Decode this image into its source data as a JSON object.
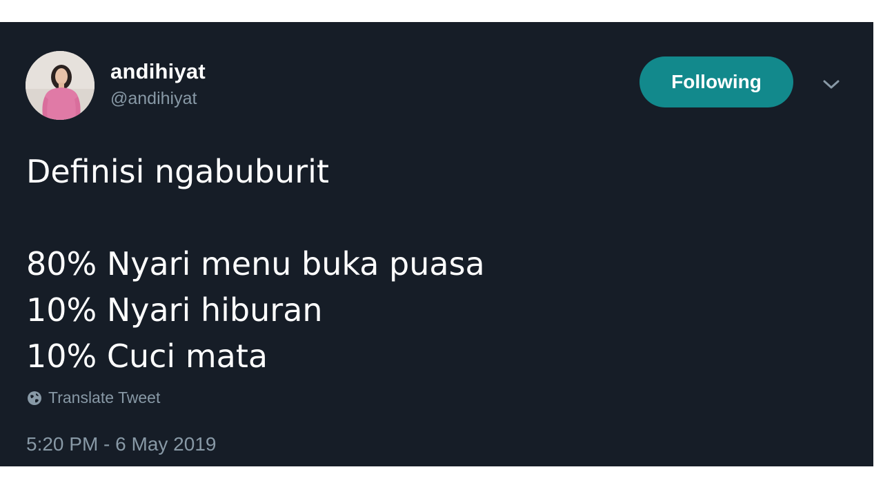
{
  "tweet": {
    "author": {
      "display_name": "andihiyat",
      "handle": "@andihiyat",
      "avatar_icon": "profile-photo"
    },
    "follow_button_label": "Following",
    "menu_icon": "chevron-down-icon",
    "lines": [
      "Definisi ngabuburit",
      "",
      "80% Nyari menu buka puasa",
      "10% Nyari hiburan",
      "10% Cuci mata"
    ],
    "translate_label": "Translate Tweet",
    "timestamp": "5:20 PM - 6 May 2019"
  },
  "colors": {
    "background": "#161d27",
    "accent": "#12898c",
    "secondary_text": "#8899a6",
    "primary_text": "#ffffff"
  }
}
